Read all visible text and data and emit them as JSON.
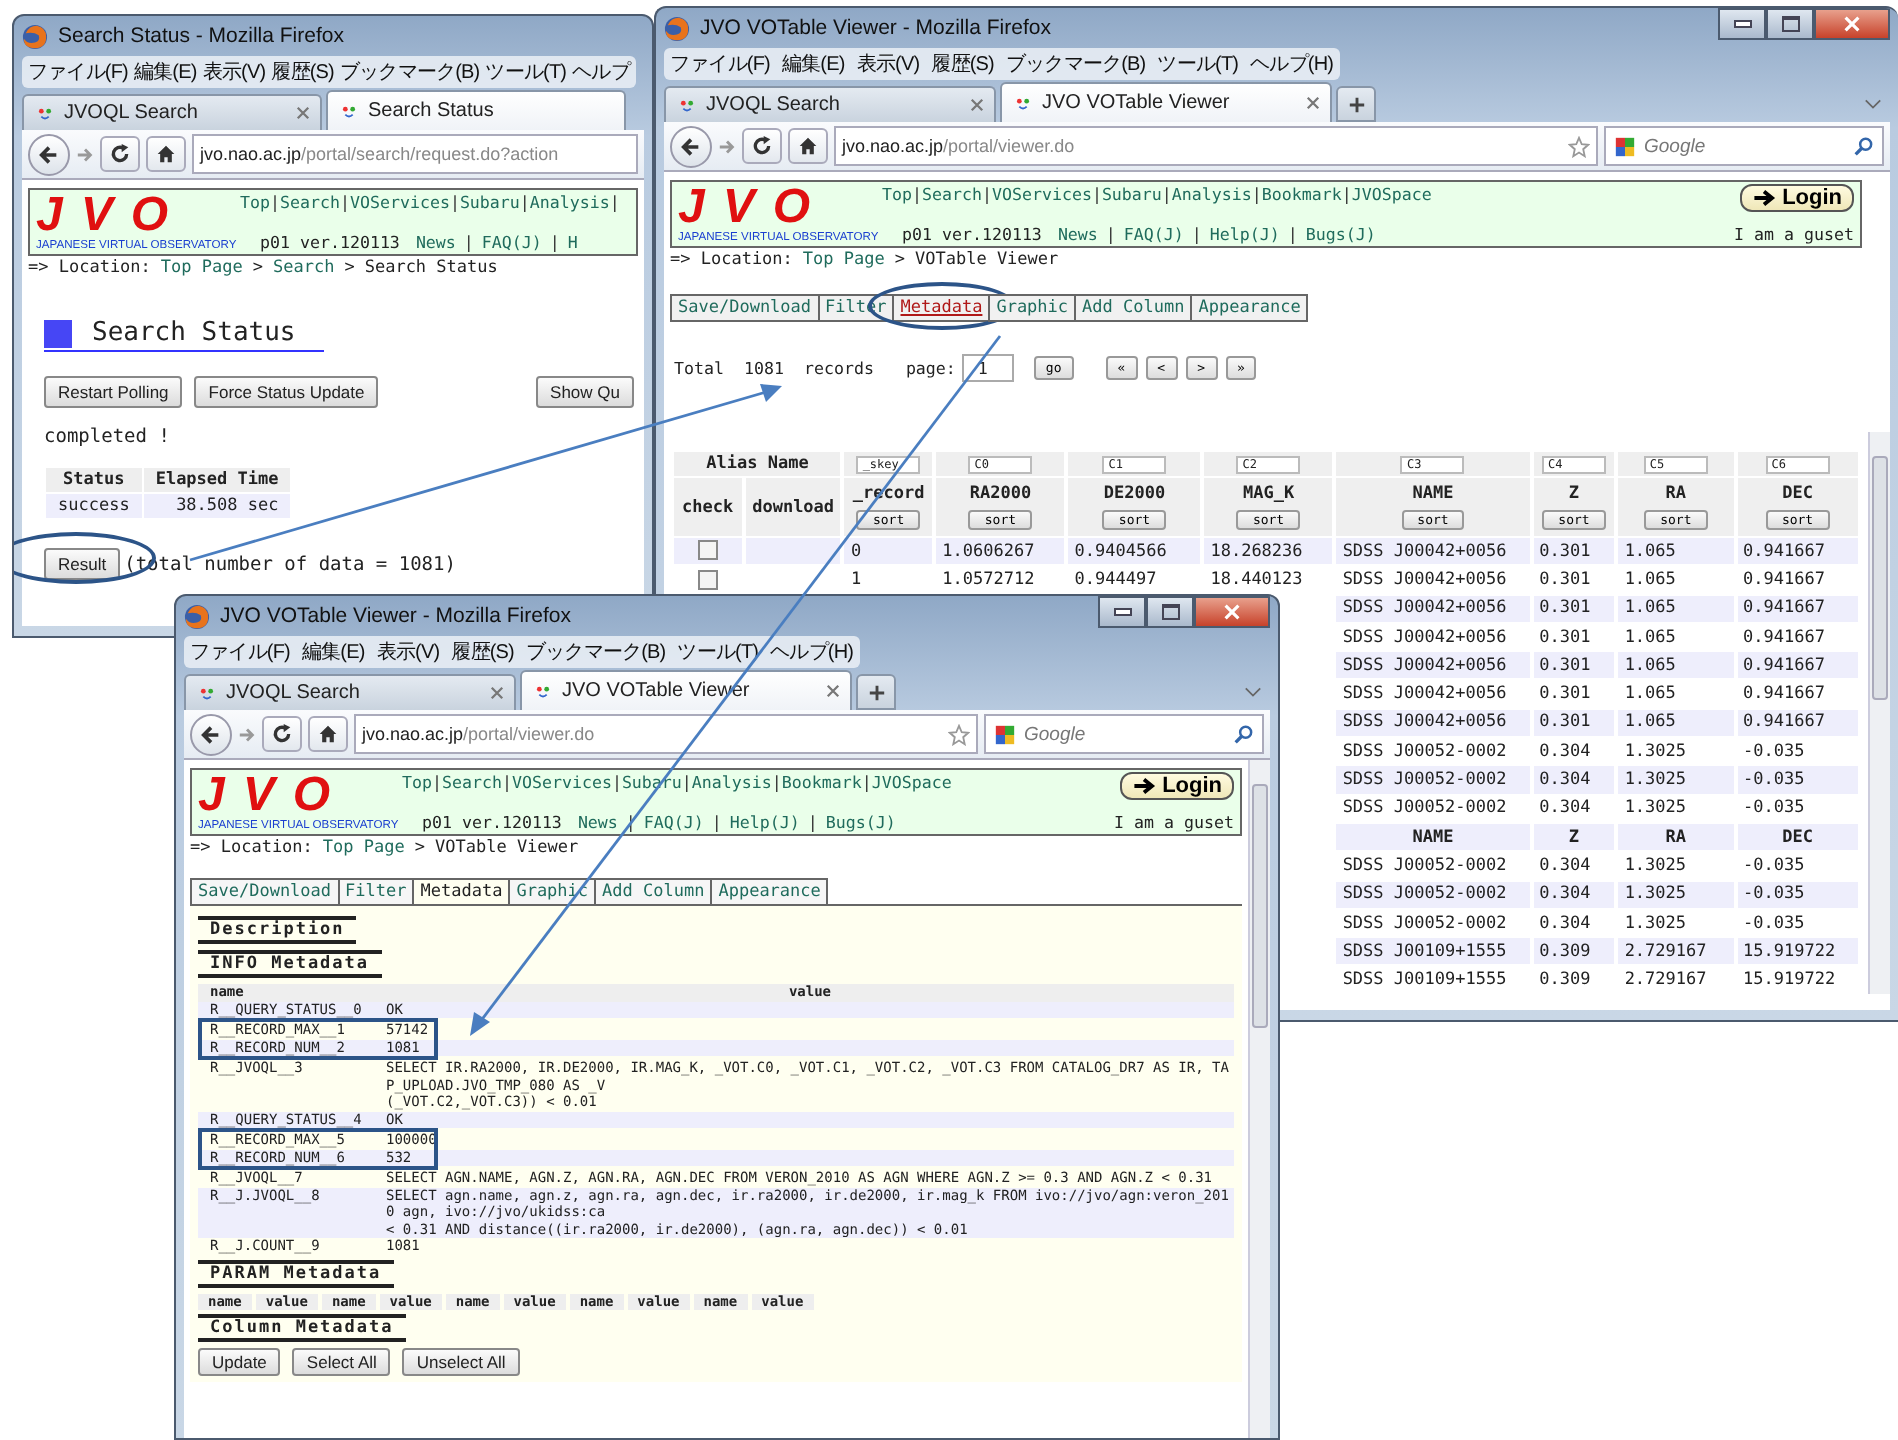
{
  "windows": [
    {
      "kind": "status",
      "title": "Search Status - Mozilla Firefox",
      "menu": [
        "ファイル(F)",
        "編集(E)",
        "表示(V)",
        "履歴(S)",
        "ブックマーク(B)",
        "ツール(T)",
        "ヘルプ"
      ],
      "tabs": [
        {
          "label": "JVOQL Search",
          "selected": false,
          "closable": true
        },
        {
          "label": "Search Status",
          "selected": true,
          "closable": false
        }
      ],
      "url": {
        "host": "jvo.nao.ac.jp",
        "path": "/portal/search/request.do?action"
      },
      "banner": {
        "logo": "JVO",
        "subtitle": "JAPANESE VIRTUAL OBSERVATORY",
        "links": [
          {
            "text": "Top",
            "sep": "|"
          },
          {
            "text": "Search",
            "sep": "|"
          },
          {
            "text": "VOServices",
            "sep": "|"
          },
          {
            "text": "Subaru",
            "sep": "|"
          },
          {
            "text": "Analysis",
            "sep": "|"
          }
        ],
        "version": "p01 ver.120113",
        "sub_links": [
          {
            "text": "News",
            "sep": "|"
          },
          {
            "text": "FAQ(J)",
            "sep": "|"
          },
          {
            "text": "H"
          }
        ]
      },
      "location": {
        "prefix": "=> Location:",
        "crumbs": [
          {
            "text": "Top Page",
            "link": true,
            "sep": ">"
          },
          {
            "text": "Search",
            "link": true,
            "sep": ">"
          },
          {
            "text": "Search Status",
            "link": false
          }
        ]
      },
      "heading": "Search Status",
      "buttons": [
        "Restart Polling",
        "Force Status Update",
        "Show Qu"
      ],
      "message": "completed !",
      "status_table": {
        "columns": [
          "Status",
          "Elapsed Time"
        ],
        "row": [
          "success",
          "38.508 sec"
        ]
      },
      "result": {
        "label": "Result",
        "circled": true,
        "note": "(total number of data = 1081)"
      }
    },
    {
      "kind": "viewer",
      "title": "JVO VOTable Viewer - Mozilla Firefox",
      "menu": [
        "ファイル(F)",
        "編集(E)",
        "表示(V)",
        "履歴(S)",
        "ブックマーク(B)",
        "ツール(T)",
        "ヘルプ(H)"
      ],
      "tabs": [
        {
          "label": "JVOQL Search",
          "selected": false,
          "closable": true
        },
        {
          "label": "JVO VOTable Viewer",
          "selected": true,
          "closable": true
        }
      ],
      "url": {
        "host": "jvo.nao.ac.jp",
        "path": "/portal/viewer.do"
      },
      "search": {
        "placeholder": "Google"
      },
      "banner": {
        "logo": "JVO",
        "subtitle": "JAPANESE VIRTUAL OBSERVATORY",
        "links": [
          {
            "text": "Top",
            "sep": "|"
          },
          {
            "text": "Search",
            "sep": "|"
          },
          {
            "text": "VOServices",
            "sep": "|"
          },
          {
            "text": "Subaru",
            "sep": "|"
          },
          {
            "text": "Analysis",
            "sep": "|"
          },
          {
            "text": "Bookmark",
            "sep": "|"
          },
          {
            "text": "JVOSpace"
          }
        ],
        "version": "p01 ver.120113",
        "sub_links": [
          {
            "text": "News",
            "sep": "|"
          },
          {
            "text": "FAQ(J)",
            "sep": "|"
          },
          {
            "text": "Help(J)",
            "sep": "|"
          },
          {
            "text": "Bugs(J)"
          }
        ],
        "login": "Login",
        "user": "I am a guset"
      },
      "location": {
        "prefix": "=> Location:",
        "crumbs": [
          {
            "text": "Top Page",
            "link": true,
            "sep": ">"
          },
          {
            "text": "VOTable Viewer",
            "link": false
          }
        ]
      },
      "view_tabs": [
        {
          "label": "Save/Download",
          "selected": false,
          "circled": false
        },
        {
          "label": "Filter",
          "selected": false,
          "circled": false
        },
        {
          "label": "Metadata",
          "selected": false,
          "circled": true
        },
        {
          "label": "Graphic",
          "selected": false,
          "circled": false
        },
        {
          "label": "Add Column",
          "selected": false,
          "circled": false
        },
        {
          "label": "Appearance",
          "selected": false,
          "circled": false
        }
      ],
      "pager": {
        "total_label": "Total",
        "total": "1081",
        "records_label": "records",
        "page_label": "page:",
        "page": "1",
        "go": "go",
        "nav": [
          "«",
          "<",
          ">",
          "»"
        ]
      },
      "table": {
        "alias_label": "Alias Name",
        "check_label": "check",
        "download_label": "download",
        "columns": [
          {
            "alias": "_skey",
            "name": "_record",
            "sort": "sort"
          },
          {
            "alias": "C0",
            "name": "RA2000",
            "sort": "sort"
          },
          {
            "alias": "C1",
            "name": "DE2000",
            "sort": "sort"
          },
          {
            "alias": "C2",
            "name": "MAG_K",
            "sort": "sort"
          },
          {
            "alias": "C3",
            "name": "NAME",
            "sort": "sort"
          },
          {
            "alias": "C4",
            "name": "Z",
            "sort": "sort"
          },
          {
            "alias": "C5",
            "name": "RA",
            "sort": "sort"
          },
          {
            "alias": "C6",
            "name": "DEC",
            "sort": "sort"
          }
        ],
        "rows": [
          {
            "kind": "data",
            "checked": false,
            "cells": [
              "0",
              "1.0606267",
              "0.9404566",
              "18.268236",
              "SDSS J00042+0056",
              "0.301",
              "1.065",
              "0.941667"
            ]
          },
          {
            "kind": "data",
            "checked": false,
            "cells": [
              "1",
              "1.0572712",
              "0.944497",
              "18.440123",
              "SDSS J00042+0056",
              "0.301",
              "1.065",
              "0.941667"
            ]
          },
          {
            "kind": "data",
            "cells": [
              "SDSS J00042+0056",
              "0.301",
              "1.065",
              "0.941667"
            ]
          },
          {
            "kind": "data",
            "cells": [
              "SDSS J00042+0056",
              "0.301",
              "1.065",
              "0.941667"
            ]
          },
          {
            "kind": "data",
            "cells": [
              "SDSS J00042+0056",
              "0.301",
              "1.065",
              "0.941667"
            ]
          },
          {
            "kind": "data",
            "cells": [
              "SDSS J00042+0056",
              "0.301",
              "1.065",
              "0.941667"
            ]
          },
          {
            "kind": "data",
            "cells": [
              "SDSS J00042+0056",
              "0.301",
              "1.065",
              "0.941667"
            ]
          },
          {
            "kind": "data",
            "cells": [
              "SDSS J00052-0002",
              "0.304",
              "1.3025",
              "-0.035"
            ]
          },
          {
            "kind": "data",
            "cells": [
              "SDSS J00052-0002",
              "0.304",
              "1.3025",
              "-0.035"
            ]
          },
          {
            "kind": "data",
            "cells": [
              "SDSS J00052-0002",
              "0.304",
              "1.3025",
              "-0.035"
            ]
          },
          {
            "kind": "header",
            "cells": [
              "NAME",
              "Z",
              "RA",
              "DEC"
            ]
          },
          {
            "kind": "data",
            "cells": [
              "SDSS J00052-0002",
              "0.304",
              "1.3025",
              "-0.035"
            ]
          },
          {
            "kind": "data",
            "cells": [
              "SDSS J00052-0002",
              "0.304",
              "1.3025",
              "-0.035"
            ]
          },
          {
            "kind": "data",
            "cells": [
              "SDSS J00052-0002",
              "0.304",
              "1.3025",
              "-0.035"
            ]
          },
          {
            "kind": "data",
            "cells": [
              "SDSS J00109+1555",
              "0.309",
              "2.729167",
              "15.919722"
            ]
          },
          {
            "kind": "data",
            "cells": [
              "SDSS J00109+1555",
              "0.309",
              "2.729167",
              "15.919722"
            ]
          }
        ]
      }
    },
    {
      "kind": "metadata",
      "title": "JVO VOTable Viewer - Mozilla Firefox",
      "menu": [
        "ファイル(F)",
        "編集(E)",
        "表示(V)",
        "履歴(S)",
        "ブックマーク(B)",
        "ツール(T)",
        "ヘルプ(H)"
      ],
      "tabs": [
        {
          "label": "JVOQL Search",
          "selected": false,
          "closable": true
        },
        {
          "label": "JVO VOTable Viewer",
          "selected": true,
          "closable": true
        }
      ],
      "url": {
        "host": "jvo.nao.ac.jp",
        "path": "/portal/viewer.do"
      },
      "search": {
        "placeholder": "Google"
      },
      "banner": {
        "logo": "JVO",
        "subtitle": "JAPANESE VIRTUAL OBSERVATORY",
        "links": [
          {
            "text": "Top",
            "sep": "|"
          },
          {
            "text": "Search",
            "sep": "|"
          },
          {
            "text": "VOServices",
            "sep": "|"
          },
          {
            "text": "Subaru",
            "sep": "|"
          },
          {
            "text": "Analysis",
            "sep": "|"
          },
          {
            "text": "Bookmark",
            "sep": "|"
          },
          {
            "text": "JVOSpace"
          }
        ],
        "version": "p01 ver.120113",
        "sub_links": [
          {
            "text": "News",
            "sep": "|"
          },
          {
            "text": "FAQ(J)",
            "sep": "|"
          },
          {
            "text": "Help(J)",
            "sep": "|"
          },
          {
            "text": "Bugs(J)"
          }
        ],
        "login": "Login",
        "user": "I am a guset"
      },
      "location": {
        "prefix": "=> Location:",
        "crumbs": [
          {
            "text": "Top Page",
            "link": true,
            "sep": ">"
          },
          {
            "text": "VOTable Viewer",
            "link": false
          }
        ]
      },
      "view_tabs": [
        {
          "label": "Save/Download",
          "selected": false,
          "circled": false
        },
        {
          "label": "Filter",
          "selected": false,
          "circled": false
        },
        {
          "label": "Metadata",
          "selected": true,
          "circled": false
        },
        {
          "label": "Graphic",
          "selected": false,
          "circled": false
        },
        {
          "label": "Add Column",
          "selected": false,
          "circled": false
        },
        {
          "label": "Appearance",
          "selected": false,
          "circled": false
        }
      ],
      "description_heading": "Description",
      "info_heading": "INFO Metadata",
      "info_columns": [
        "name",
        "value"
      ],
      "info_rows": [
        {
          "name": "R__QUERY_STATUS__0",
          "lines": [
            "OK"
          ],
          "highlighted": false
        },
        {
          "name": "R__RECORD_MAX__1",
          "lines": [
            "57142"
          ],
          "highlighted": true
        },
        {
          "name": "R__RECORD_NUM__2",
          "lines": [
            "1081"
          ],
          "highlighted": true
        },
        {
          "name": "R__JVOQL__3",
          "lines": [
            "SELECT IR.RA2000, IR.DE2000, IR.MAG_K, _VOT.C0, _VOT.C1, _VOT.C2, _VOT.C3 FROM CATALOG_DR7 AS IR, TAP_UPLOAD.JVO_TMP_080 AS _V",
            "(_VOT.C2,_VOT.C3)) < 0.01"
          ],
          "highlighted": false
        },
        {
          "name": "R__QUERY_STATUS__4",
          "lines": [
            "OK"
          ],
          "highlighted": false
        },
        {
          "name": "R__RECORD_MAX__5",
          "lines": [
            "100000"
          ],
          "highlighted": true
        },
        {
          "name": "R__RECORD_NUM__6",
          "lines": [
            "532"
          ],
          "highlighted": true
        },
        {
          "name": "R__JVOQL__7",
          "lines": [
            "SELECT AGN.NAME, AGN.Z, AGN.RA, AGN.DEC FROM VERON_2010 AS AGN WHERE AGN.Z >= 0.3 AND AGN.Z < 0.31"
          ],
          "highlighted": false
        },
        {
          "name": "R__J.JVOQL__8",
          "lines": [
            "SELECT agn.name, agn.z, agn.ra, agn.dec, ir.ra2000, ir.de2000, ir.mag_k FROM ivo://jvo/agn:veron_2010 agn, ivo://jvo/ukidss:ca",
            "< 0.31 AND distance((ir.ra2000, ir.de2000), (agn.ra, agn.dec)) < 0.01"
          ],
          "highlighted": false
        },
        {
          "name": "R__J.COUNT__9",
          "lines": [
            "1081"
          ],
          "highlighted": false
        }
      ],
      "param_heading": "PARAM Metadata",
      "param_columns": [
        "name",
        "value",
        "name",
        "value",
        "name",
        "value",
        "name",
        "value",
        "name",
        "value"
      ],
      "column_heading": "Column Metadata",
      "buttons": [
        "Update",
        "Select All",
        "Unselect All"
      ]
    }
  ]
}
